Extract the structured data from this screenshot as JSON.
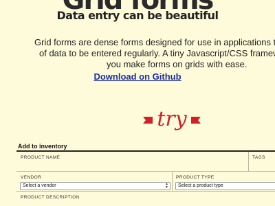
{
  "header": {
    "logo_text": "Grid forms",
    "tagline": "Data entry can be beautiful"
  },
  "intro": {
    "line1": "Grid forms are dense forms designed for use in applications that re",
    "line2": "of data to be entered regularly. A tiny Javascript/CSS framework th",
    "line3": "you make forms on grids with ease."
  },
  "links": {
    "github": "Download on Github"
  },
  "try_banner": {
    "text": "try",
    "color": "#d31f26"
  },
  "form": {
    "title": "Add to inventory",
    "fields": {
      "product_name_label": "Product Name",
      "tags_label": "Tags",
      "vendor_label": "Vendor",
      "vendor_value": "Select a vendor",
      "product_type_label": "Product Type",
      "product_type_value": "Select a product type",
      "product_description_label": "Product Description"
    }
  },
  "colors": {
    "background": "#fdfbd9",
    "link": "#1c2fa6",
    "accent": "#d31f26"
  }
}
